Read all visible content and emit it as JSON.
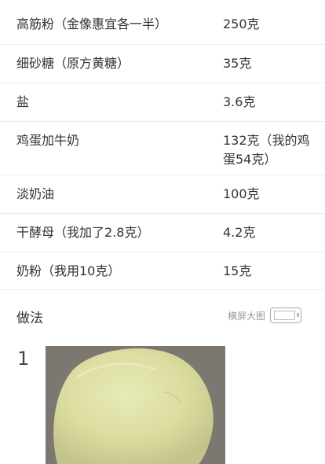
{
  "ingredients": [
    {
      "name": "高筋粉（金像惠宜各一半）",
      "amount": "250克"
    },
    {
      "name": "细砂糖（原方黄糖）",
      "amount": "35克"
    },
    {
      "name": "盐",
      "amount": "3.6克"
    },
    {
      "name": "鸡蛋加牛奶",
      "amount": "132克（我的鸡蛋54克）"
    },
    {
      "name": "淡奶油",
      "amount": "100克"
    },
    {
      "name": "干酵母（我加了2.8克）",
      "amount": "4.2克"
    },
    {
      "name": "奶粉（我用10克）",
      "amount": "15克"
    }
  ],
  "method": {
    "title": "做法",
    "landscape_label": "横屏大图",
    "landscape_icon": "phone-landscape-icon"
  },
  "steps": [
    {
      "number": "1",
      "photo": "dough-ball-photo"
    }
  ],
  "colors": {
    "text": "#333333",
    "muted": "#999999",
    "divider": "#ececec"
  }
}
